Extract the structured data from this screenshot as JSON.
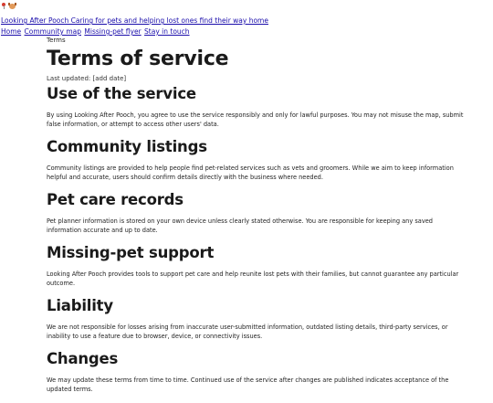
{
  "header": {
    "icons": [
      "pin-icon",
      "dog-icon"
    ],
    "brand_link": "Looking After Pooch Caring for pets and helping lost ones find their way home"
  },
  "nav": {
    "items": [
      "Home",
      "Community map",
      "Missing-pet flyer",
      "Stay in touch"
    ]
  },
  "page": {
    "breadcrumb": "Terms",
    "title": "Terms of service",
    "last_updated": "Last updated: [add date]"
  },
  "sections": [
    {
      "heading": "Use of the service",
      "body": "By using Looking After Pooch, you agree to use the service responsibly and only for lawful purposes. You may not misuse the map, submit false information, or attempt to access other users' data."
    },
    {
      "heading": "Community listings",
      "body": "Community listings are provided to help people find pet-related services such as vets and groomers. While we aim to keep information helpful and accurate, users should confirm details directly with the business where needed."
    },
    {
      "heading": "Pet care records",
      "body": "Pet planner information is stored on your own device unless clearly stated otherwise. You are responsible for keeping any saved information accurate and up to date."
    },
    {
      "heading": "Missing-pet support",
      "body": "Looking After Pooch provides tools to support pet care and help reunite lost pets with their families, but cannot guarantee any particular outcome."
    },
    {
      "heading": "Liability",
      "body": "We are not responsible for losses arising from inaccurate user-submitted information, outdated listing details, third-party services, or inability to use a feature due to browser, device, or connectivity issues."
    },
    {
      "heading": "Changes",
      "body": "We may update these terms from time to time. Continued use of the service after changes are published indicates acceptance of the updated terms."
    }
  ]
}
